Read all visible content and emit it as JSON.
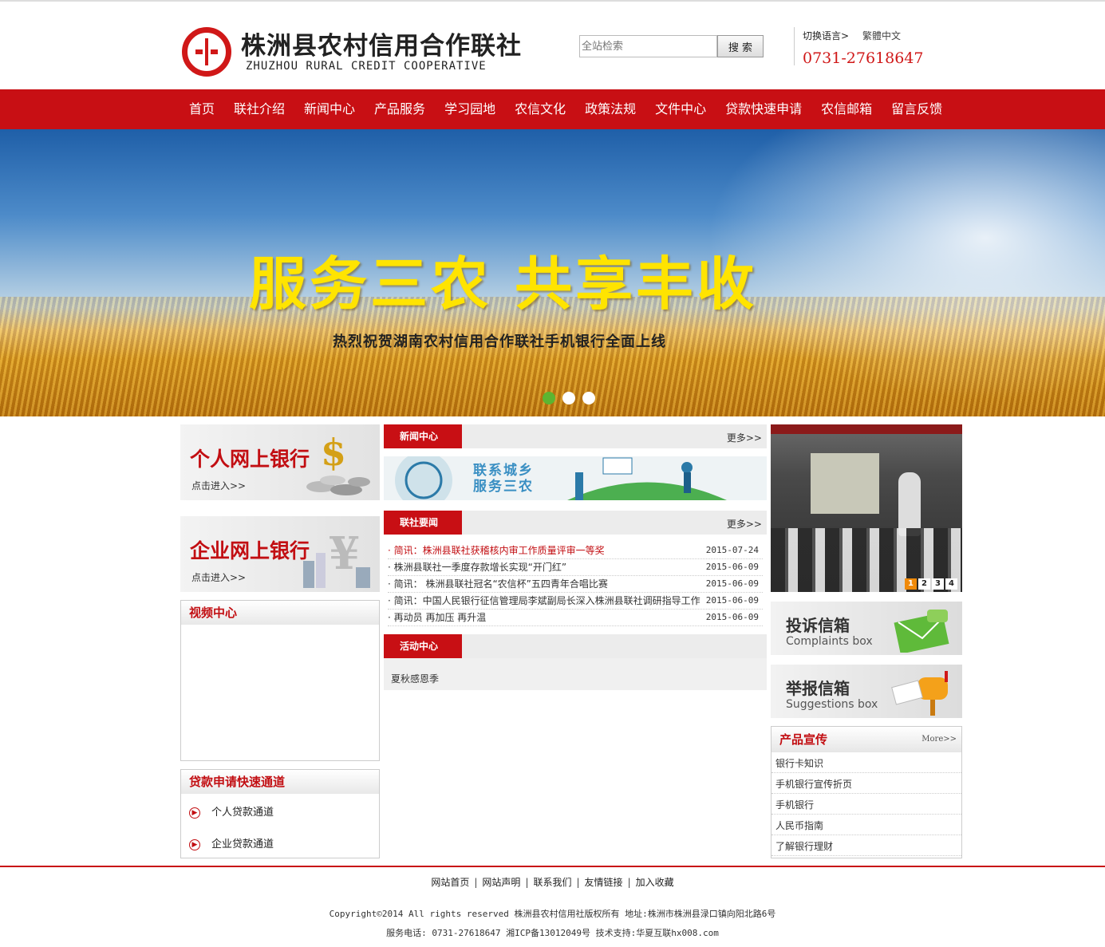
{
  "header": {
    "logo_cn": "株洲县农村信用合作联社",
    "logo_en": "ZHUZHOU RURAL CREDIT COOPERATIVE",
    "search_placeholder": "全站检索",
    "search_button": "搜 索",
    "lang_switch": "切换语言>",
    "lang_traditional": "繁體中文",
    "hotline": "0731-27618647"
  },
  "nav": {
    "items": [
      "首页",
      "联社介绍",
      "新闻中心",
      "产品服务",
      "学习园地",
      "农信文化",
      "政策法规",
      "文件中心",
      "贷款快速申请",
      "农信邮箱",
      "留言反馈"
    ]
  },
  "banner": {
    "title": "服务三农  共享丰收",
    "subtitle": "热烈祝贺湖南农村信用合作联社手机银行全面上线",
    "slides": 3,
    "active_slide": 1
  },
  "left": {
    "personal_bank": {
      "title": "个人网上银行",
      "enter": "点击进入>>"
    },
    "corporate_bank": {
      "title": "企业网上银行",
      "enter": "点击进入>>"
    },
    "video_title": "视频中心",
    "loan_title": "贷款申请快速通道",
    "loan_items": [
      "个人贷款通道",
      "企业贷款通道"
    ]
  },
  "middle": {
    "news_center": {
      "tag": "新闻中心",
      "more": "更多>>"
    },
    "promo_text_1": "联系城乡",
    "promo_text_2": "服务三农",
    "union_news": {
      "tag": "联社要闻",
      "more": "更多>>"
    },
    "news": [
      {
        "title": "· 简讯：株洲县联社获稽核内审工作质量评审一等奖",
        "date": "2015-07-24"
      },
      {
        "title": "· 株洲县联社一季度存款增长实现“开门红”",
        "date": "2015-06-09"
      },
      {
        "title": "· 简讯： 株洲县联社冠名“农信杯”五四青年合唱比赛",
        "date": "2015-06-09"
      },
      {
        "title": "· 简讯：中国人民银行征信管理局李斌副局长深入株洲县联社调研指导工作",
        "date": "2015-06-09"
      },
      {
        "title": "· 再动员 再加压 再升温",
        "date": "2015-06-09"
      }
    ],
    "activity": {
      "tag": "活动中心",
      "item": "夏秋感恩季"
    }
  },
  "right": {
    "slider_pages": [
      "1",
      "2",
      "3",
      "4"
    ],
    "complaints": {
      "title": "投诉信箱",
      "en": "Complaints box"
    },
    "suggestions": {
      "title": "举报信箱",
      "en": "Suggestions box"
    },
    "products": {
      "title": "产品宣传",
      "more": "More>>",
      "items": [
        "银行卡知识",
        "手机银行宣传折页",
        "手机银行",
        "人民币指南",
        "了解银行理财"
      ]
    }
  },
  "footer": {
    "links": [
      "网站首页",
      "网站声明",
      "联系我们",
      "友情链接",
      "加入收藏"
    ],
    "copyright": "Copyright©2014 All rights reserved 株洲县农村信用社版权所有 地址:株洲市株洲县渌口镇向阳北路6号",
    "service": "服务电话: 0731-27618647 湘ICP备13012049号 技术支持:华夏互联hx008.com"
  },
  "colors": {
    "brand_red": "#c80f14",
    "banner_yellow": "#ffe400",
    "slider_active": "#5cb531"
  }
}
